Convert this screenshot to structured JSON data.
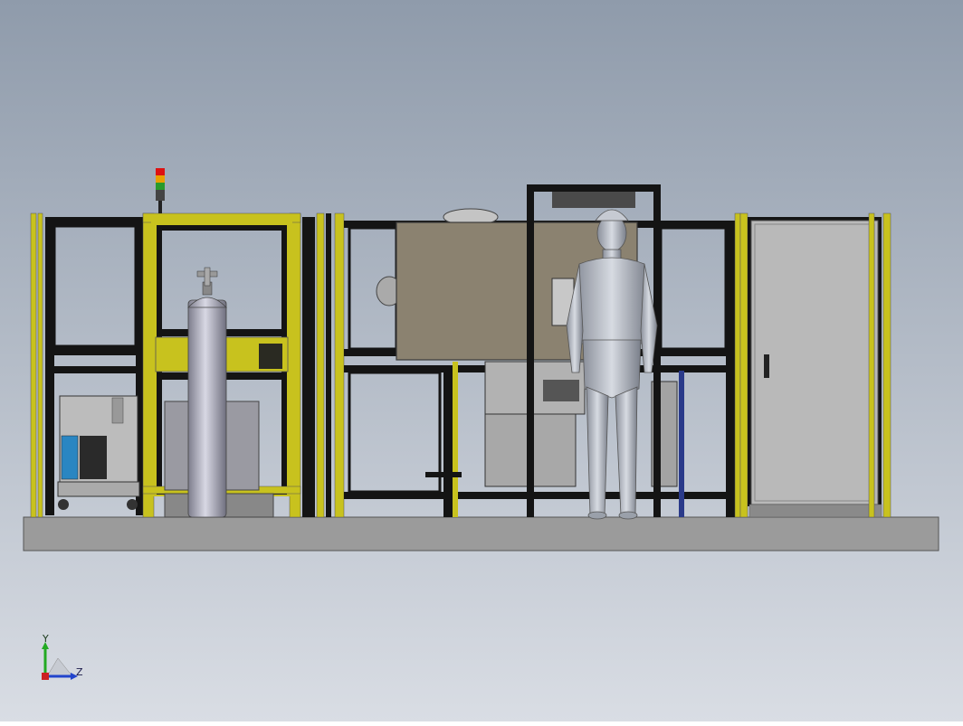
{
  "scene": {
    "background_top": "#8f9bab",
    "background_bottom": "#d9dde4"
  },
  "triad": {
    "y_label": "Y",
    "z_label": "Z",
    "y_color": "#22aa22",
    "z_color": "#2244cc"
  },
  "colors": {
    "frame_black": "#141414",
    "frame_yellow": "#c8c21e",
    "panel_tan": "#8b8270",
    "cabinet_grey": "#b9b9b9",
    "base_grey": "#9b9b9b",
    "cylinder_grey": "#a9a9b8"
  }
}
